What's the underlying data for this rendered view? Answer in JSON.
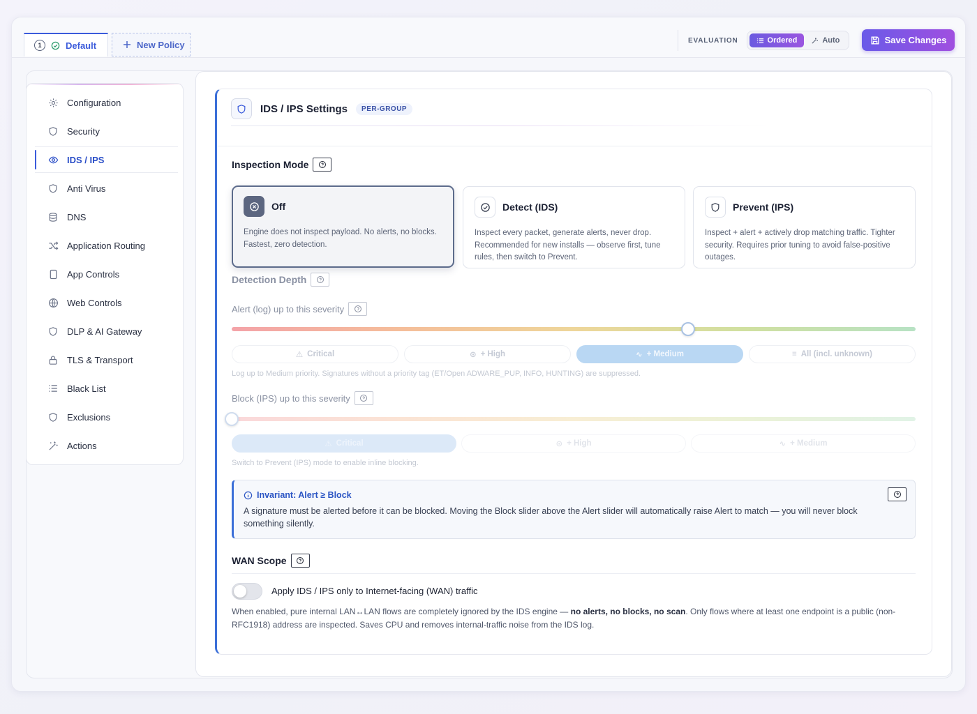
{
  "header": {
    "tabs": [
      {
        "badge": "1",
        "label": "Default"
      },
      {
        "label": "New Policy"
      }
    ],
    "evaluation_label": "EVALUATION",
    "evaluation_options": [
      "Ordered",
      "Auto"
    ],
    "save_label": "Save Changes"
  },
  "sidebar": {
    "items": [
      {
        "label": "Configuration",
        "icon": "gear-icon"
      },
      {
        "label": "Security",
        "icon": "shield-icon"
      },
      {
        "label": "IDS / IPS",
        "icon": "eye-icon"
      },
      {
        "label": "Anti Virus",
        "icon": "shield-icon"
      },
      {
        "label": "DNS",
        "icon": "database-icon"
      },
      {
        "label": "Application Routing",
        "icon": "shuffle-icon"
      },
      {
        "label": "App Controls",
        "icon": "phone-icon"
      },
      {
        "label": "Web Controls",
        "icon": "globe-icon"
      },
      {
        "label": "DLP & AI Gateway",
        "icon": "shield-icon"
      },
      {
        "label": "TLS & Transport",
        "icon": "lock-icon"
      },
      {
        "label": "Black List",
        "icon": "list-icon"
      },
      {
        "label": "Exclusions",
        "icon": "shield-icon"
      },
      {
        "label": "Actions",
        "icon": "wand-icon"
      }
    ],
    "active_index": 2
  },
  "card": {
    "title": "IDS / IPS Settings",
    "pill": "PER-GROUP"
  },
  "inspection": {
    "title": "Inspection Mode",
    "modes": [
      {
        "title": "Off",
        "desc": "Engine does not inspect payload. No alerts, no blocks. Fastest, zero detection.",
        "selected": true
      },
      {
        "title": "Detect (IDS)",
        "desc": "Inspect every packet, generate alerts, never drop. Recommended for new installs — observe first, tune rules, then switch to Prevent."
      },
      {
        "title": "Prevent (IPS)",
        "desc": "Inspect + alert + actively drop matching traffic. Tighter security. Requires prior tuning to avoid false-positive outages."
      }
    ]
  },
  "detection": {
    "title": "Detection Depth",
    "alert_label": "Alert (log) up to this severity",
    "alert_level": 0.667,
    "alert_chips": [
      "Critical",
      "+ High",
      "+ Medium",
      "All (incl. unknown)"
    ],
    "alert_active": 2,
    "alert_note": "Log up to Medium priority. Signatures without a priority tag (ET/Open ADWARE_PUP, INFO, HUNTING) are suppressed.",
    "block_label": "Block (IPS) up to this severity",
    "block_level": 0,
    "block_chips": [
      "Critical",
      "+ High",
      "+ Medium"
    ],
    "block_active": 0,
    "block_note": "Switch to Prevent (IPS) mode to enable inline blocking."
  },
  "invariant": {
    "title": "Invariant: Alert ≥ Block",
    "text": "A signature must be alerted before it can be blocked. Moving the Block slider above the Alert slider will automatically raise Alert to match — you will never block something silently."
  },
  "wan": {
    "title": "WAN Scope",
    "toggle_label": "Apply IDS / IPS only to Internet-facing (WAN) traffic",
    "toggle_on": false,
    "desc_pre": "When enabled, pure internal LAN↔LAN flows are completely ignored by the IDS engine — ",
    "desc_bold": "no alerts, no blocks, no scan",
    "desc_post": ". Only flows where at least one endpoint is a public (non-RFC1918) address are inspected. Saves CPU and removes internal-traffic noise from the IDS log."
  },
  "colors": {
    "accent": "#3b5bdb",
    "save_gradient_start": "#6a5ae8",
    "save_gradient_end": "#a04fe0",
    "medium_chip": "#b9d7f3"
  }
}
